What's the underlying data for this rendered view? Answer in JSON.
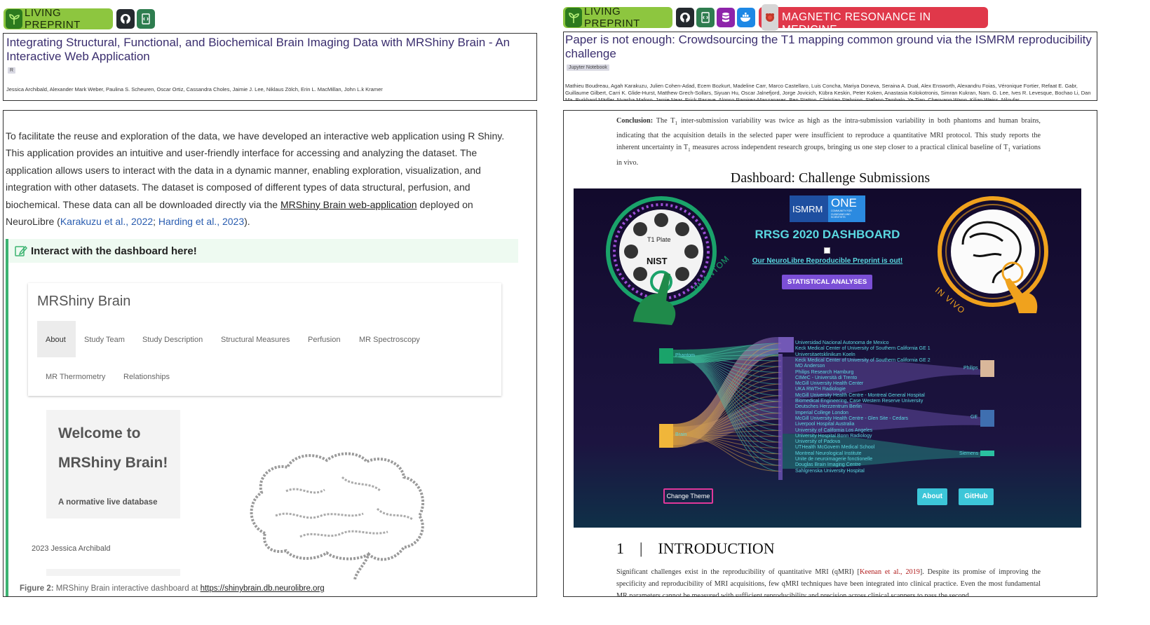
{
  "left": {
    "badge_label": "LIVING PREPRINT",
    "title": "Integrating Structural, Functional, and Biochemical Brain Imaging Data with MRShiny Brain - An Interactive Web Application",
    "tag": "R",
    "authors": "Jessica Archibald, Alexander Mark Weber, Paulina S. Scheuren, Oscar Ortiz, Cassandra Choles, Jaimie J. Lee, Niklaus Zölch, Erin L. MacMillan, John L.k Kramer",
    "body": {
      "text1": "To facilitate the reuse and exploration of the data, we have developed an interactive web application using R Shiny. This application provides an intuitive and user-friendly interface for accessing and analyzing the dataset. The application allows users to interact with the data in a dynamic manner, enabling exploration, visualization, and integration with other datasets. The dataset is composed of different types of data structural, perfusion, and biochemical. These data can all be downloaded directly via the ",
      "link1": "MRShiny Brain web-application",
      "text2": " deployed on NeuroLibre (",
      "cite1": "Karakuzu et al., 2022",
      "sep": "; ",
      "cite2": "Harding et al., 2023",
      "text3": ")."
    },
    "callout": "Interact with the dashboard here!",
    "shiny": {
      "title": "MRShiny Brain",
      "tabs": [
        "About",
        "Study Team",
        "Study Description",
        "Structural Measures",
        "Perfusion",
        "MR Spectroscopy",
        "MR Thermometry",
        "Relationships"
      ],
      "welcome_line1": "Welcome to",
      "welcome_line2": "MRShiny Brain!",
      "welcome_sub": "A normative live database",
      "copyright": "2023 Jessica Archibald"
    },
    "figure_caption_label": "Figure 2:",
    "figure_caption_text": " MRShiny Brain interactive dashboard at ",
    "figure_caption_link": "https://shinybrain.db.neurolibre.org"
  },
  "right": {
    "badge_label": "LIVING PREPRINT",
    "journal_label": "MAGNETIC RESONANCE IN MEDICINE",
    "title": "Paper is not enough: Crowdsourcing the T1 mapping common ground via the ISMRM reproducibility challenge",
    "tag": "Jupyter Notebook",
    "authors": "Mathieu Boudreau, Agah Karakuzu, Julien Cohen-Adad, Ecem Bozkurt, Madeline Carr, Marco Castellaro, Luis Concha, Mariya Doneva, Seraina A. Dual, Alex Ensworth, Alexandru Foias, Véronique Fortier, Refaat E. Gabr, Guillaume Gilbert, Carri K. Glide-Hurst, Matthew Grech-Sollars, Siyuan Hu, Oscar Jalnefjord, Jorge Jovicich, Kübra Keskin, Peter Koken, Anastasia Kolokotronis, Simran Kukran, Nam. G. Lee, Ives R. Levesque, Bochao Li, Dan Ma, Burkhard Mädler, Nyasha Maforo, Jamie Near, Erick Pasaye, Alonso Ramirez-Manzanares, Ben Statton, Christian Stehning, Stefano Tambalo, Ye Tian, Chenyang Wang, Kilian Weiss, Niloufar",
    "conclusion_label": "Conclusion:",
    "conclusion_p1": " The T",
    "conclusion_p2": " inter-submission variability was twice as high as the intra-submission variability in both phantoms and human brains, indicating that the acquisition details in the selected paper were insufficient to reproduce a quantitative MRI protocol. This study reports the inherent uncertainty in T",
    "conclusion_p3": " measures across independent research groups, bringing us one step closer to a practical clinical baseline of T",
    "conclusion_p4": " variations in vivo.",
    "sub1": "1",
    "dashboard_caption": "Dashboard: Challenge Submissions",
    "dashboard": {
      "ismrm_label": "ISMRM",
      "one_label": "ONE",
      "one_sub": "COMMUNITY FOR CLINICIANS AND SCIENTISTS",
      "title": "RRSG 2020 DASHBOARD",
      "preprint_link": "Our NeuroLibre Reproducible Preprint is out!",
      "stats_button": "STATISTICAL ANALYSES",
      "plate_label": "T1 Plate",
      "nist_label": "NIST",
      "phantom_label": "PHANTOM",
      "invivo_label": "IN VIVO",
      "change_theme": "Change Theme",
      "about": "About",
      "github": "GitHub",
      "sources": [
        "Phantom",
        "Brain"
      ],
      "sites": [
        "Universidad Nacional Autonoma de Mexico",
        "Keck Medical Center of University of Southern California GE 1",
        "Universitaetsklinikum Koeln",
        "Keck Medical Center of University of Southern California GE 2",
        "MD Anderson",
        "Philips Research Hamburg",
        "CIMeC - Università di Trento",
        "McGill University Health Center",
        "UKA RWTH Radiologie",
        "McGill University Health Centre - Montreal General Hospital",
        "Biomedical Engineering, Case Western Reserve University",
        "Deutsches Herzzentrum Berlin",
        "Imperial College London",
        "McGill University Health Centre - Glen Site - Cedars",
        "Liverpool Hospital Australia",
        "University of California Los Angeles",
        "University Hospital Bonn Radiology",
        "University of Padova",
        "UTHealth McGovern Medical School",
        "Montreal Neurological Institute",
        "Unite de neuroimagerie fonctionelle",
        "Douglas Brain Imaging Centre",
        "Sahlgrenska University Hospital"
      ],
      "vendors": [
        "Philips",
        "GE",
        "Siemens"
      ]
    },
    "section_num": "1",
    "section_title": "INTRODUCTION",
    "intro_p1": "Significant challenges exist in the reproducibility of quantitative MRI (qMRI) [",
    "intro_cite": "Keenan et al., 2019",
    "intro_p2": "]. Despite its promise of improving the specificity and reproducibility of MRI acquisitions, few qMRI techniques have been integrated into clinical practice. Even the most fundamental MR parameters cannot be measured with sufficient reproducibility and precision across clinical scanners to pass the second"
  },
  "colors": {
    "living_green": "#8dc63f",
    "sprout_green": "#2c7a1e",
    "journal_red": "#e0384a",
    "dash_bg": "#150e30",
    "phantom_green": "#1aa36a",
    "brain_gold": "#e8a93a",
    "link_blue": "#2a5db0"
  }
}
